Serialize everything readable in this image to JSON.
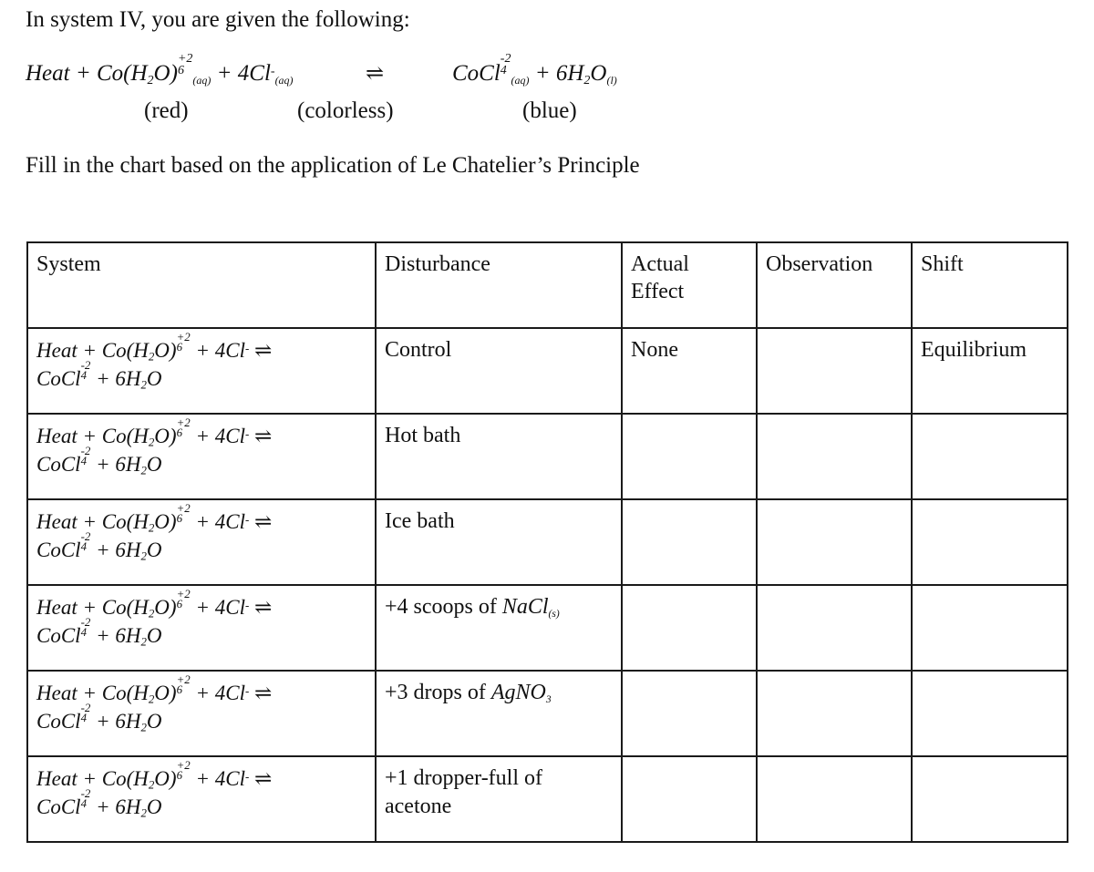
{
  "intro": {
    "line": "In system IV, you are given the following:"
  },
  "equation": {
    "reactant_heat": "Heat",
    "plus": "+",
    "reactant_complex": {
      "formula": "Co(H",
      "sub2": "2",
      "mid": "O)",
      "sub6": "6",
      "charge": "+2",
      "state": "(aq)"
    },
    "reactant_chloride": {
      "coefficient": "4",
      "symbol": "Cl",
      "charge": "-",
      "state": "(aq)"
    },
    "arrow": "⇌",
    "product_complex": {
      "formula": "CoCl",
      "sub4": "4",
      "charge": "-2",
      "state": "(aq)"
    },
    "product_water": {
      "coefficient": "6",
      "formula": "H",
      "sub2": "2",
      "symbol": "O",
      "state": "(l)"
    },
    "color_labels": {
      "reactant_complex": "(red)",
      "reactant_chloride": "(colorless)",
      "product_complex": "(blue)"
    }
  },
  "instruction": {
    "text": "Fill in the chart based on the application of Le Chatelier’s Principle"
  },
  "chart": {
    "headers": {
      "system": "System",
      "disturbance": "Disturbance",
      "actual_effect_line1": "Actual",
      "actual_effect_line2": "Effect",
      "observation": "Observation",
      "shift": "Shift"
    },
    "system_equation": {
      "line1_a": "Heat + Co(H",
      "line1_sub2": "2",
      "line1_b": "O)",
      "line1_sub6": "6",
      "line1_charge": "+2",
      "line1_c": " + 4Cl",
      "line1_clcharge": "-",
      "line1_arrow": "⇌",
      "line2_a": "CoCl",
      "line2_sub4": "4",
      "line2_charge": "-2",
      "line2_b": " + 6H",
      "line2_sub2": "2",
      "line2_c": "O"
    },
    "rows": [
      {
        "disturbance_text": "Control",
        "disturbance_chem": "",
        "disturbance_chem_state": "",
        "actual_effect": "None",
        "observation": "",
        "shift": "Equilibrium"
      },
      {
        "disturbance_text": "Hot bath",
        "disturbance_chem": "",
        "disturbance_chem_state": "",
        "actual_effect": "",
        "observation": "",
        "shift": ""
      },
      {
        "disturbance_text": "Ice bath",
        "disturbance_chem": "",
        "disturbance_chem_state": "",
        "actual_effect": "",
        "observation": "",
        "shift": ""
      },
      {
        "disturbance_text": "+4 scoops of ",
        "disturbance_chem": "NaCl",
        "disturbance_chem_state": "(s)",
        "actual_effect": "",
        "observation": "",
        "shift": ""
      },
      {
        "disturbance_text": "+3 drops of ",
        "disturbance_chem": "AgNO",
        "disturbance_chem_state": "3",
        "actual_effect": "",
        "observation": "",
        "shift": ""
      },
      {
        "disturbance_text": "+1 dropper-full of acetone",
        "disturbance_chem": "",
        "disturbance_chem_state": "",
        "actual_effect": "",
        "observation": "",
        "shift": ""
      }
    ]
  }
}
